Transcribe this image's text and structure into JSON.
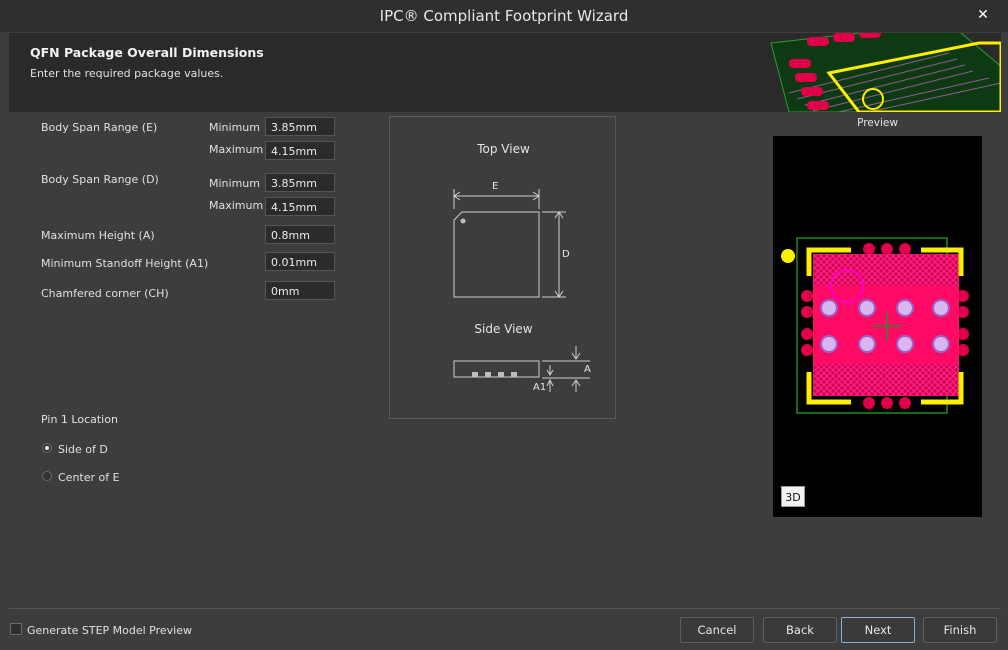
{
  "window": {
    "title": "IPC® Compliant Footprint Wizard",
    "close_glyph": "✕"
  },
  "header": {
    "title": "QFN Package Overall Dimensions",
    "subtitle": "Enter the required package values."
  },
  "form": {
    "body_span_e": {
      "label": "Body Span Range (E)",
      "min_label": "Minimum",
      "max_label": "Maximum",
      "min": "3.85mm",
      "max": "4.15mm"
    },
    "body_span_d": {
      "label": "Body Span Range (D)",
      "min_label": "Minimum",
      "max_label": "Maximum",
      "min": "3.85mm",
      "max": "4.15mm"
    },
    "max_height": {
      "label": "Maximum Height (A)",
      "value": "0.8mm"
    },
    "min_standoff": {
      "label": "Minimum Standoff Height (A1)",
      "value": "0.01mm"
    },
    "chamfer": {
      "label": "Chamfered corner (CH)",
      "value": "0mm"
    }
  },
  "diagram": {
    "top_view": "Top View",
    "side_view": "Side View",
    "dim_e": "E",
    "dim_d": "D",
    "dim_a": "A",
    "dim_a1": "A1"
  },
  "pin1": {
    "heading": "Pin 1 Location",
    "options": [
      {
        "label": "Side of D",
        "selected": true
      },
      {
        "label": "Center of E",
        "selected": false
      }
    ]
  },
  "preview": {
    "label": "Preview",
    "btn_3d": "3D"
  },
  "footer": {
    "step_checkbox_label": "Generate STEP Model Preview",
    "step_checked": false,
    "cancel": "Cancel",
    "back": "Back",
    "next": "Next",
    "finish": "Finish"
  },
  "colors": {
    "pad_red": "#e0004a",
    "silkscreen_yellow": "#ffee00",
    "courtyard_green": "#1f8a1f",
    "hatch_magenta": "#ff00c8"
  },
  "icons": {
    "close": "close-icon",
    "preview_3d": "3d-toggle-icon"
  }
}
